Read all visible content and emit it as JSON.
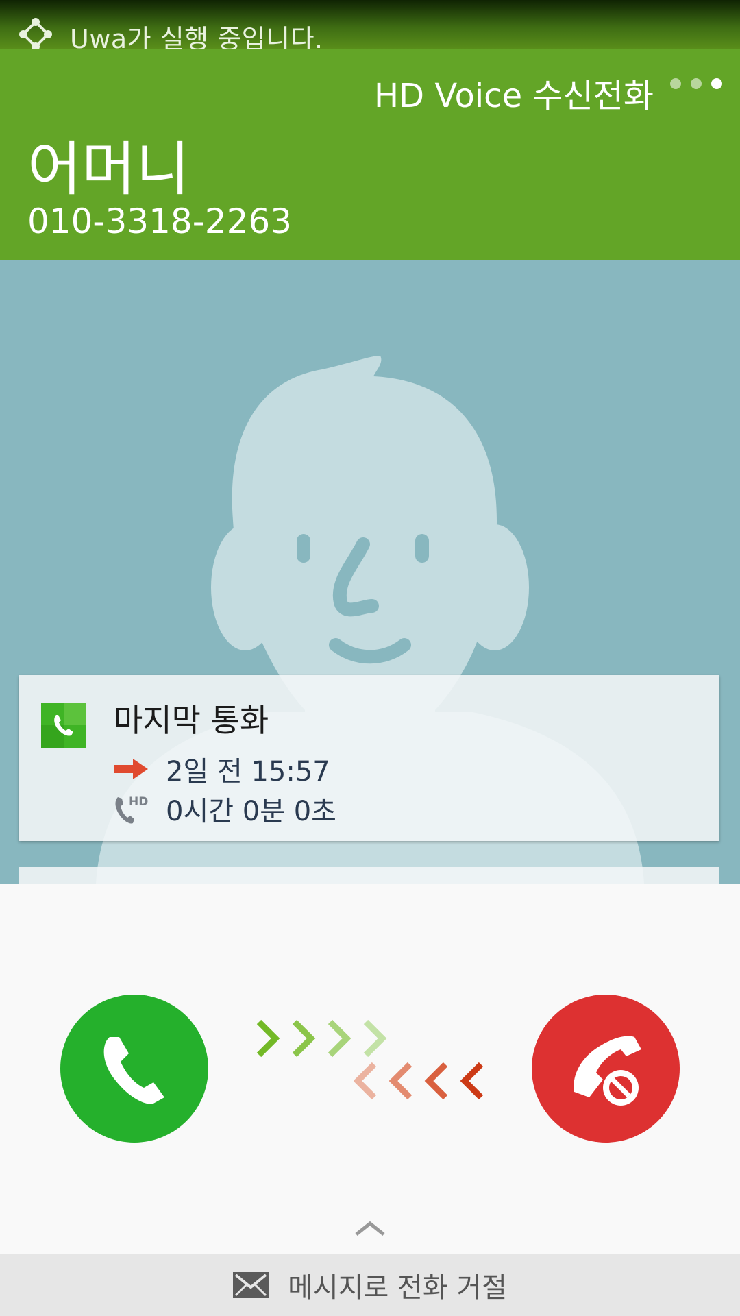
{
  "status_bar": {
    "notification_text": "Uwa가 실행 중입니다.",
    "icon": "nodes-icon"
  },
  "call": {
    "call_type": "HD Voice 수신전화",
    "caller_name": "어머니",
    "caller_number": "010-3318-2263",
    "page_indicator_count": 3,
    "page_indicator_active": 3
  },
  "last_call_card": {
    "title": "마지막 통화",
    "direction_icon": "outgoing-arrow-icon",
    "time": "2일 전 15:57",
    "duration_icon": "hd-call-icon",
    "duration": "0시간 0분 0초",
    "app_icon": "phone-app-icon"
  },
  "actions": {
    "accept_icon": "phone-icon",
    "decline_icon": "phone-decline-icon",
    "reject_with_message_label": "메시지로 전화 거절",
    "reject_with_message_icon": "mail-icon"
  },
  "colors": {
    "header": "#63a527",
    "background": "#88b7bf",
    "accept": "#25b02c",
    "decline": "#dd3131"
  }
}
